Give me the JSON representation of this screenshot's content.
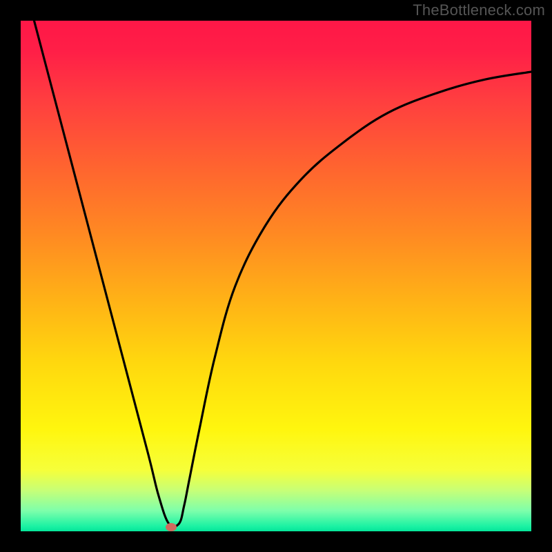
{
  "watermark": "TheBottleneck.com",
  "colors": {
    "background": "#000000",
    "curve": "#000000",
    "marker": "#cf6a5e",
    "gradient_top": "#ff1747",
    "gradient_bottom": "#04e59a"
  },
  "chart_data": {
    "type": "line",
    "title": "",
    "xlabel": "",
    "ylabel": "",
    "xlim": [
      0,
      100
    ],
    "ylim": [
      0,
      100
    ],
    "series": [
      {
        "name": "bottleneck-curve",
        "x": [
          0,
          5,
          10,
          15,
          20,
          25,
          27,
          29,
          31,
          32,
          33,
          35,
          38,
          42,
          48,
          55,
          63,
          72,
          82,
          91,
          100
        ],
        "values": [
          110,
          91,
          72,
          53,
          34,
          15,
          7,
          1.5,
          1.5,
          5,
          10,
          20,
          34,
          48,
          60,
          69,
          76,
          82,
          86,
          88.5,
          90
        ]
      }
    ],
    "marker": {
      "x": 29.5,
      "y": 0.8
    },
    "grid": false,
    "legend": false
  }
}
